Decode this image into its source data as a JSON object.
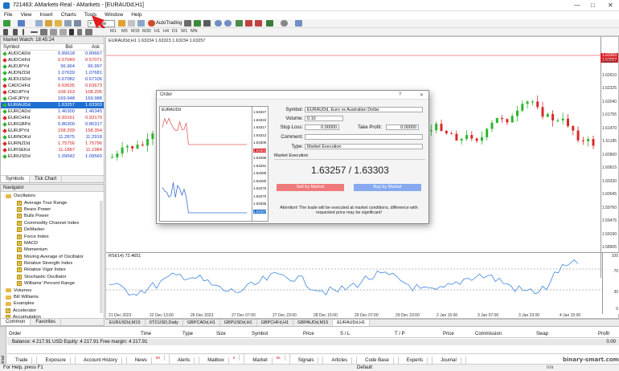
{
  "window": {
    "title": "721463: AMarkets-Real - AMarkets - [EURAUDd,H1]",
    "controls": [
      "—",
      "□",
      "✕"
    ]
  },
  "menu": [
    "File",
    "View",
    "Insert",
    "Charts",
    "Tools",
    "Window",
    "Help"
  ],
  "toolbar": {
    "new_order": "New Order",
    "autotrading": "AutoTrading",
    "timeframes": [
      "M1",
      "M5",
      "M15",
      "M30",
      "H1",
      "H4",
      "D1",
      "W1",
      "MN"
    ]
  },
  "market_watch": {
    "header": "Market Watch: 18:45:24",
    "columns": [
      "Symbol",
      "Bid",
      "Ask"
    ],
    "rows": [
      {
        "symbol": "AUDCADd",
        "bid": "0.89618",
        "ask": "0.89667",
        "dir": "up"
      },
      {
        "symbol": "AUDCHFd",
        "bid": "0.57049",
        "ask": "0.57071",
        "dir": "down"
      },
      {
        "symbol": "AUDJPYd",
        "bid": "96.964",
        "ask": "96.997",
        "dir": "up"
      },
      {
        "symbol": "AUDNZDd",
        "bid": "1.07639",
        "ask": "1.07681",
        "dir": "up"
      },
      {
        "symbol": "AUDUSDd",
        "bid": "0.67082",
        "ask": "0.67106",
        "dir": "up"
      },
      {
        "symbol": "CADCHFd",
        "bid": "0.63635",
        "ask": "0.63673",
        "dir": "down"
      },
      {
        "symbol": "CADJPYd",
        "bid": "108.163",
        "ask": "108.205",
        "dir": "down"
      },
      {
        "symbol": "CHFJPYd",
        "bid": "169.948",
        "ask": "169.988",
        "dir": "up"
      },
      {
        "symbol": "EURAUDd",
        "bid": "1.63257",
        "ask": "1.63303",
        "dir": "up",
        "selected": true
      },
      {
        "symbol": "EURCADd",
        "bid": "1.46300",
        "ask": "1.46345",
        "dir": "up"
      },
      {
        "symbol": "EURCHFd",
        "bid": "0.93161",
        "ask": "0.93179",
        "dir": "down"
      },
      {
        "symbol": "EURGBPd",
        "bid": "0.86300",
        "ask": "0.86317",
        "dir": "up"
      },
      {
        "symbol": "EURJPYd",
        "bid": "158.339",
        "ask": "158.354",
        "dir": "down"
      },
      {
        "symbol": "EURNOKd",
        "bid": "11.2875",
        "ask": "11.2918",
        "dir": "up"
      },
      {
        "symbol": "EURNZDd",
        "bid": "1.75756",
        "ask": "1.75796",
        "dir": "down"
      },
      {
        "symbol": "EURSEKd",
        "bid": "11.1887",
        "ask": "11.1984",
        "dir": "down"
      },
      {
        "symbol": "EURUSDd",
        "bid": "1.09542",
        "ask": "1.09560",
        "dir": "up"
      }
    ],
    "tabs": [
      "Symbols",
      "Tick Chart"
    ]
  },
  "navigator": {
    "header": "Navigator",
    "items": [
      {
        "label": "Oscillators",
        "kind": "folder",
        "level": 1
      },
      {
        "label": "Average True Range",
        "kind": "ind",
        "level": 2
      },
      {
        "label": "Bears Power",
        "kind": "ind",
        "level": 2
      },
      {
        "label": "Bulls Power",
        "kind": "ind",
        "level": 2
      },
      {
        "label": "Commodity Channel Index",
        "kind": "ind",
        "level": 2
      },
      {
        "label": "DeMarker",
        "kind": "ind",
        "level": 2
      },
      {
        "label": "Force Index",
        "kind": "ind",
        "level": 2
      },
      {
        "label": "MACD",
        "kind": "ind",
        "level": 2
      },
      {
        "label": "Momentum",
        "kind": "ind",
        "level": 2
      },
      {
        "label": "Moving Average of Oscillator",
        "kind": "ind",
        "level": 2
      },
      {
        "label": "Relative Strength Index",
        "kind": "ind",
        "level": 2
      },
      {
        "label": "Relative Vigor Index",
        "kind": "ind",
        "level": 2
      },
      {
        "label": "Stochastic Oscillator",
        "kind": "ind",
        "level": 2
      },
      {
        "label": "Williams' Percent Range",
        "kind": "ind",
        "level": 2
      },
      {
        "label": "Volumes",
        "kind": "folder",
        "level": 1
      },
      {
        "label": "Bill Williams",
        "kind": "folder",
        "level": 1
      },
      {
        "label": "Examples",
        "kind": "folder",
        "level": 1
      },
      {
        "label": "Accelerator",
        "kind": "ind",
        "level": 1
      },
      {
        "label": "Accumulation",
        "kind": "ind",
        "level": 1
      }
    ],
    "tabs": [
      "Common",
      "Favorites"
    ]
  },
  "chart": {
    "info": "EURAUDd,H1  1.63234 1.63323 1.63234 1.63257",
    "price_labels": [
      "1.63303",
      "1.63257",
      "1.63270",
      "1.62610",
      "1.62325",
      "1.62040",
      "1.61755",
      "1.61470",
      "1.61185",
      "1.60900",
      "1.60615",
      "1.60330",
      "1.60045",
      "1.59760",
      "1.59475",
      "1.59190",
      "1.58905",
      "1.58620"
    ],
    "rsi_label": "RSI(14) 72.4651",
    "rsi_scale": [
      "100",
      "70",
      "30",
      "0"
    ],
    "dates": [
      "21 Dec 2023",
      "22 Dec 13:00",
      "26 Dec 2023",
      "27 Dec 07:00",
      "27 Dec 23:00",
      "28 Dec 15:00",
      "29 Dec 07:00",
      "29 Dec 23:00",
      "2 Jan 15:00",
      "3 Jan 07:00",
      "3 Jan 23:00",
      "4 Jan 15:00"
    ],
    "tabs": [
      "EURUSDd,M15",
      "XTCUSD,Daily",
      "GBPCADd,H1",
      "GBPUSDd,H1",
      "GBPCHFd,H1",
      "GBPAUDd,M15",
      "EURAUDd,H1"
    ],
    "active_tab": "EURAUDd,H1"
  },
  "order": {
    "title": "Order",
    "mini_symbol": "EURAUDd",
    "mini_scale": [
      "1.63327",
      "1.63322",
      "1.63317",
      "1.63312",
      "1.63306",
      "1.63301",
      "1.63296",
      "1.63291",
      "1.63286",
      "1.63280",
      "1.63275",
      "1.63270",
      "1.63265",
      "1.63257"
    ],
    "symbol_label": "Symbol:",
    "symbol_value": "EURAUDd, Euro vs Australian Dollar",
    "volume_label": "Volume:",
    "volume_value": "0.10",
    "sl_label": "Stop Loss:",
    "sl_value": "0.00000",
    "tp_label": "Take Profit:",
    "tp_value": "0.00000",
    "comment_label": "Comment:",
    "type_label": "Type:",
    "type_value": "Market Execution",
    "section": "Market Execution",
    "price": "1.63257 / 1.63303",
    "sell": "Sell by Market",
    "buy": "Buy by Market",
    "warning": "Attention! The trade will be executed at market conditions, difference with requested price may be significant!"
  },
  "terminal": {
    "columns": [
      "Order",
      "Time",
      "Type",
      "Size",
      "Symbol",
      "Price",
      "S / L",
      "T / P",
      "Price",
      "Commission",
      "Swap",
      "Profit"
    ],
    "balance": "Balance: 4 217.91 USD  Equity: 4 217.91  Free margin: 4 217.91",
    "balance_profit": "0.00",
    "tabs": [
      {
        "label": "Trade",
        "count": ""
      },
      {
        "label": "Exposure",
        "count": ""
      },
      {
        "label": "Account History",
        "count": ""
      },
      {
        "label": "News",
        "count": "99"
      },
      {
        "label": "Alerts",
        "count": ""
      },
      {
        "label": "Mailbox",
        "count": "6"
      },
      {
        "label": "Market",
        "count": "96"
      },
      {
        "label": "Signals",
        "count": ""
      },
      {
        "label": "Articles",
        "count": ""
      },
      {
        "label": "Code Base",
        "count": ""
      },
      {
        "label": "Experts",
        "count": ""
      },
      {
        "label": "Journal",
        "count": ""
      }
    ],
    "side": "Terminal"
  },
  "status": {
    "left": "For Help, press F1",
    "profile": "Default",
    "conn": "n/a",
    "watermark": "binary-smart.com"
  },
  "colors": {
    "accent": "#1f6fd1",
    "bull": "#2db52d",
    "bear": "#d92a2a",
    "sell": "#f07a7a",
    "buy": "#86a9f0"
  }
}
